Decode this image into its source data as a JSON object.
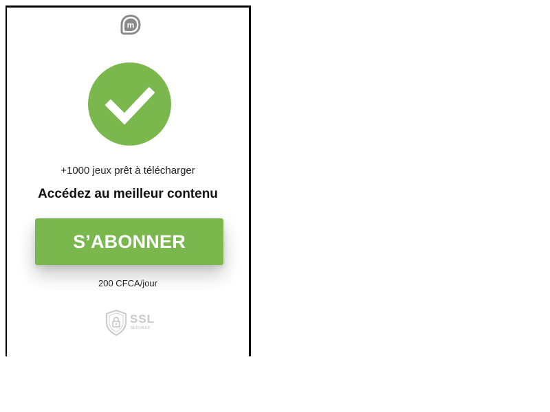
{
  "logo": {
    "icon": "m-logo-icon",
    "letter": "m",
    "color": "#7a7a7a"
  },
  "status": {
    "icon": "checkmark-icon",
    "color": "#7ab84d"
  },
  "promo": {
    "subtitle": "+1000 jeux prêt à télécharger",
    "headline": "Accédez au meilleur contenu"
  },
  "subscribe": {
    "label": "S’ABONNER",
    "color": "#7ab84d"
  },
  "pricing": {
    "text": "200 CFCA/jour"
  },
  "ssl": {
    "icon": "shield-lock-icon",
    "label": "SSL",
    "sublabel": "SECURED",
    "color": "#c9c9c9"
  }
}
